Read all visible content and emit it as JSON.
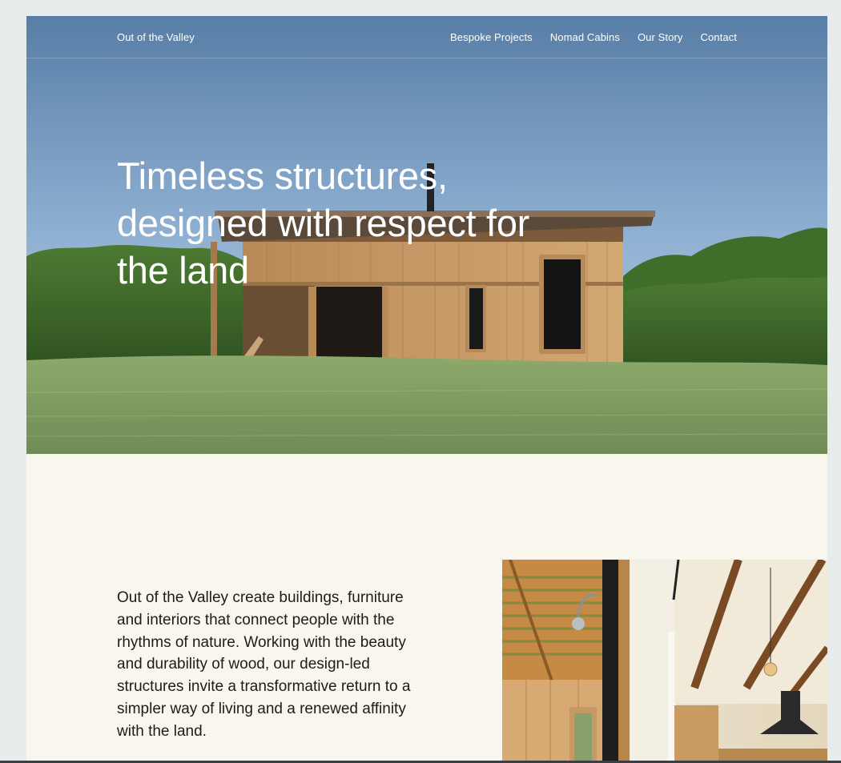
{
  "site": {
    "brand": "Out of the Valley",
    "nav": [
      {
        "label": "Bespoke Projects"
      },
      {
        "label": "Nomad Cabins"
      },
      {
        "label": "Our Story"
      },
      {
        "label": "Contact"
      }
    ]
  },
  "hero": {
    "headline": "Timeless structures, designed with respect for the land"
  },
  "intro": {
    "paragraph": "Out of the Valley create buildings, furniture and interiors that connect people with the rhythms of nature. Working with the beauty and durability of wood, our design-led structures invite a transformative return to a simpler way of living and a renewed affinity with the land."
  },
  "colors": {
    "sky_top": "#5a7fa8",
    "sky_bottom": "#b7d0e6",
    "page_bg": "#f9f6ee",
    "outer_bg": "#e8ebec",
    "wood": "#c79a66",
    "grass": "#8aa86a"
  }
}
